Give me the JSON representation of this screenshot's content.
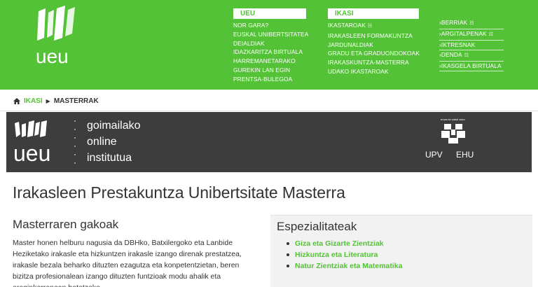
{
  "header": {
    "logo_text": "ueu",
    "ueu_col": {
      "title": "UEU",
      "items": [
        "NOR GARA?",
        "EUSKAL UNIBERTSITATEA",
        "DEIALDIAK",
        "IDAZKARITZA BIRTUALA",
        "HARREMANETARAKO",
        "GUREKIN LAN EGIN",
        "PRENTSA-BULEGOA"
      ]
    },
    "ikasi_col": {
      "title": "IKASI",
      "items": [
        "IKASTAROAK",
        "IRAKASLEEN FORMAKUNTZA",
        "JARDUNALDIAK",
        "GRADU ETA GRADUONDOKOAK",
        "IRAKASKUNTZA-MASTERRA",
        "UDAKO IKASTAROAK"
      ]
    },
    "right_links": [
      "BERRIAK",
      "ARGITALPENAK",
      "IKTRESNAK",
      "DENDA",
      "IKASGELA BIRTUALA"
    ]
  },
  "breadcrumb": {
    "parent": "IKASI",
    "current": "MASTERRAK"
  },
  "banner": {
    "logo_text": "ueu",
    "tagline": [
      "goimailako",
      "online",
      "institutua"
    ],
    "upv_small": "eman ta zabal zazu",
    "upv_left": "UPV",
    "upv_right": "EHU"
  },
  "main": {
    "title": "Irakasleen Prestakuntza Unibertsitate Masterra",
    "left_heading": "Masterraren gakoak",
    "left_text": "Master honen helburu nagusia da DBHko, Batxilergoko eta Lanbide Heziketako irakasle eta hizkuntzen irakasle izango direnak prestatzea, irakasle bezala beharko dituzten ezagutza eta konpetentzietan, beren bizitza profesionalean izango dituzten funtzioak modu ahalik eta eraginkorrenean betetzeko.",
    "right_heading": "Espezialitateak",
    "specialties": [
      "Giza eta Gizarte Zientziak",
      "Hizkuntza eta Literatura",
      "Natur Zientziak eta Matematika"
    ]
  },
  "colors": {
    "brand_green": "#54c237",
    "banner_bg": "#3d3d3d"
  }
}
